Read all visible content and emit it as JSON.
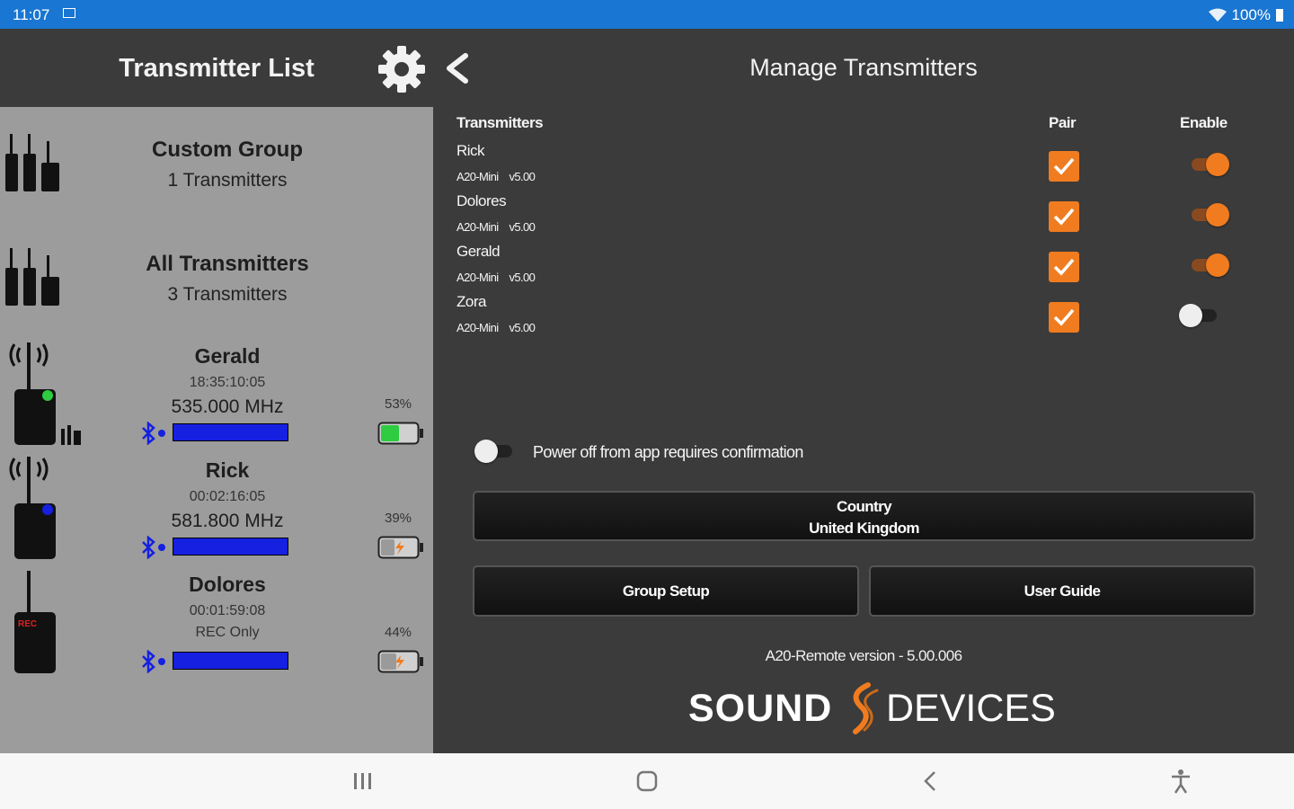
{
  "status_bar": {
    "time": "11:07",
    "battery_text": "100%"
  },
  "left_header": {
    "title": "Transmitter List"
  },
  "right_header": {
    "title": "Manage Transmitters"
  },
  "groups": [
    {
      "name": "Custom Group",
      "count": "1 Transmitters"
    },
    {
      "name": "All Transmitters",
      "count": "3 Transmitters"
    }
  ],
  "transmitters_list": [
    {
      "name": "Gerald",
      "time": "18:35:10:05",
      "info": "535.000 MHz",
      "battery_pct": "53%",
      "status_color": "#2ecc40",
      "battery_level": 0.53
    },
    {
      "name": "Rick",
      "time": "00:02:16:05",
      "info": "581.800 MHz",
      "battery_pct": "39%",
      "status_color": "#1520e0",
      "battery_level": 0.39
    },
    {
      "name": "Dolores",
      "time": "00:01:59:08",
      "info": "REC Only",
      "battery_pct": "44%",
      "status_color": "#e02020",
      "battery_level": 0.44,
      "rec_label": "REC"
    }
  ],
  "manage": {
    "col_transmitters": "Transmitters",
    "col_pair": "Pair",
    "col_enable": "Enable",
    "rows": [
      {
        "name": "Rick",
        "model": "A20-Mini",
        "version": "v5.00",
        "paired": true,
        "enabled": true
      },
      {
        "name": "Dolores",
        "model": "A20-Mini",
        "version": "v5.00",
        "paired": true,
        "enabled": true
      },
      {
        "name": "Gerald",
        "model": "A20-Mini",
        "version": "v5.00",
        "paired": true,
        "enabled": true
      },
      {
        "name": "Zora",
        "model": "A20-Mini",
        "version": "v5.00",
        "paired": true,
        "enabled": false
      }
    ],
    "power_off_confirm": {
      "label": "Power off from app requires confirmation",
      "enabled": false
    },
    "country": {
      "title": "Country",
      "value": "United Kingdom"
    },
    "group_setup": "Group Setup",
    "user_guide": "User Guide",
    "version": "A20-Remote version - 5.00.006",
    "logo_left": "SOUND",
    "logo_right": "DEVICES"
  },
  "colors": {
    "accent": "#f07c1f",
    "status_bar": "#1976d2",
    "left_panel": "#9c9c9c",
    "bar_blue": "#1520e0"
  }
}
